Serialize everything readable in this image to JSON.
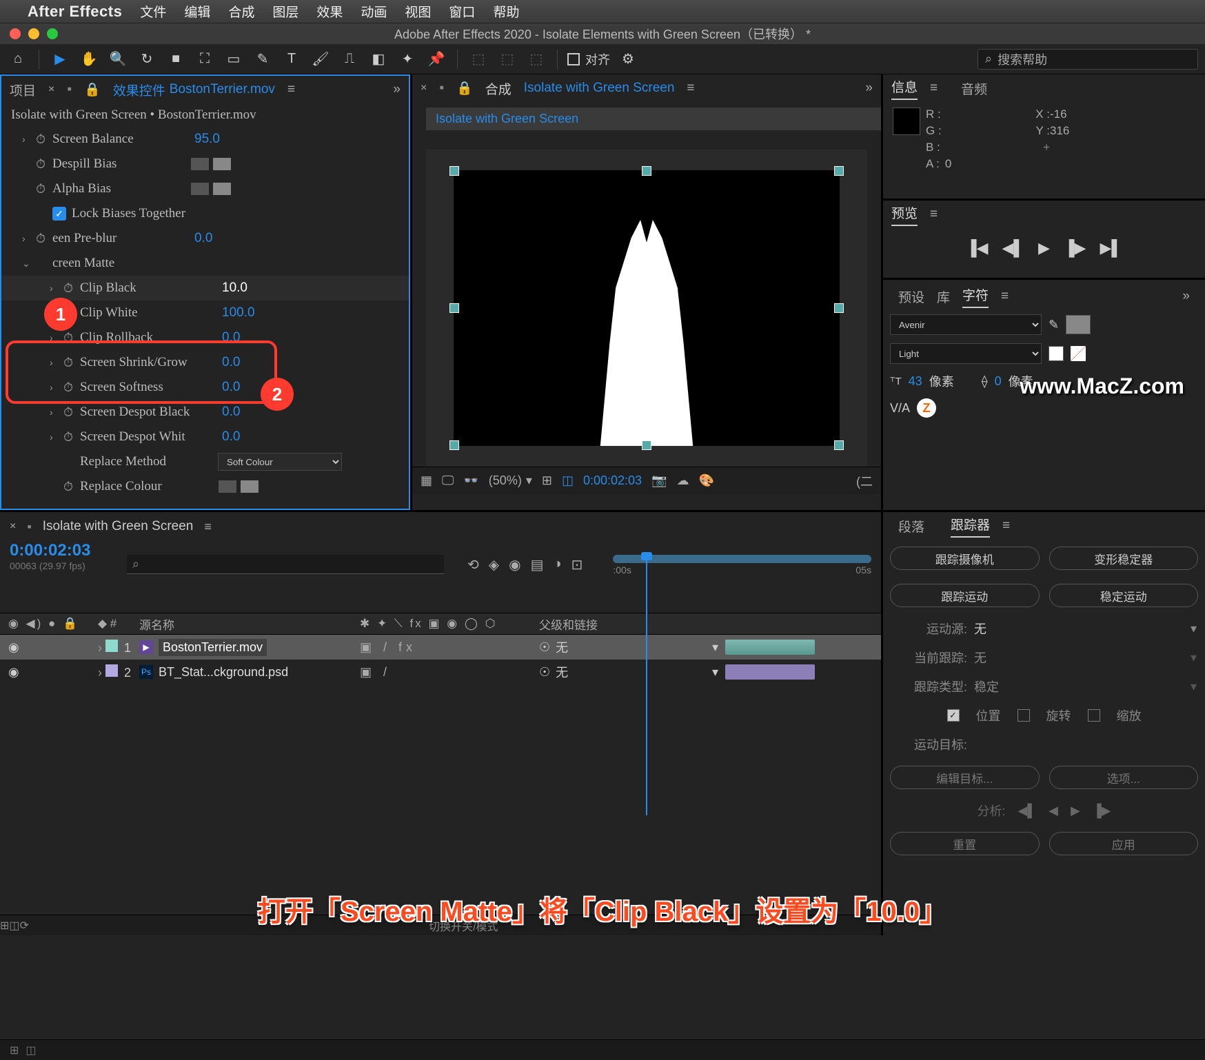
{
  "menubar": {
    "app_name": "After Effects",
    "items": [
      "文件",
      "编辑",
      "合成",
      "图层",
      "效果",
      "动画",
      "视图",
      "窗口",
      "帮助"
    ]
  },
  "window": {
    "title": "Adobe After Effects 2020 - Isolate Elements with Green Screen（已转换） *"
  },
  "toolbar": {
    "align_label": "对齐",
    "search_placeholder": "搜索帮助"
  },
  "effect_panel": {
    "tab_project": "项目",
    "tab_fx": "效果控件",
    "tab_fx_file": "BostonTerrier.mov",
    "crumb": "Isolate with Green Screen • BostonTerrier.mov",
    "props": [
      {
        "name": "Screen Balance",
        "value": "95.0",
        "chev": true,
        "stop": true
      },
      {
        "name": "Despill Bias",
        "value": "",
        "chev": false,
        "stop": true,
        "swatch": true
      },
      {
        "name": "Alpha Bias",
        "value": "",
        "chev": false,
        "stop": true,
        "swatch": true
      },
      {
        "name": "",
        "value": "Lock Biases Together",
        "checkbox": true
      },
      {
        "name": "een Pre-blur",
        "value": "0.0",
        "chev": true,
        "stop": true
      },
      {
        "name": "creen Matte",
        "value": "",
        "chev": true,
        "expanded": true
      },
      {
        "name": "Clip Black",
        "value": "10.0",
        "chev": true,
        "stop": true,
        "indent": true,
        "selected": true,
        "val_white": true
      },
      {
        "name": "Clip White",
        "value": "100.0",
        "chev": true,
        "stop": true,
        "indent": true
      },
      {
        "name": "Clip Rollback",
        "value": "0.0",
        "chev": true,
        "stop": true,
        "indent": true
      },
      {
        "name": "Screen Shrink/Grow",
        "value": "0.0",
        "chev": true,
        "stop": true,
        "indent": true
      },
      {
        "name": "Screen Softness",
        "value": "0.0",
        "chev": true,
        "stop": true,
        "indent": true
      },
      {
        "name": "Screen Despot Black",
        "value": "0.0",
        "chev": true,
        "stop": true,
        "indent": true
      },
      {
        "name": "Screen Despot Whit",
        "value": "0.0",
        "chev": true,
        "stop": true,
        "indent": true
      },
      {
        "name": "Replace Method",
        "value": "Soft Colour",
        "select": true,
        "indent": true
      },
      {
        "name": "Replace Colour",
        "value": "",
        "stop": true,
        "swatch": true,
        "indent": true
      }
    ],
    "badges": {
      "one": "1",
      "two": "2"
    }
  },
  "comp_panel": {
    "tab_label": "合成",
    "tab_name": "Isolate with Green Screen",
    "tag": "Isolate with Green Screen",
    "footer": {
      "zoom": "(50%)",
      "time": "0:00:02:03",
      "mode": "(二"
    }
  },
  "info_panel": {
    "tab_info": "信息",
    "tab_audio": "音频",
    "r_label": "R :",
    "g_label": "G :",
    "b_label": "B :",
    "a_label": "A :",
    "a_val": "0",
    "x_label": "X :",
    "x_val": "-16",
    "y_label": "Y :",
    "y_val": "316"
  },
  "preview_panel": {
    "tab": "预览"
  },
  "preset_tabs": {
    "presets": "预设",
    "library": "库",
    "character": "字符"
  },
  "char_panel": {
    "font": "Avenir",
    "weight": "Light",
    "size_label": "像素",
    "size": "43",
    "lead_label": "像素",
    "lead": "0",
    "watermark": "www.MacZ.com"
  },
  "timeline": {
    "comp_name": "Isolate with Green Screen",
    "timecode": "0:00:02:03",
    "fps": "00063 (29.97 fps)",
    "col_source": "源名称",
    "col_parent": "父级和链接",
    "ticks": [
      ":00s",
      "05s"
    ],
    "layers": [
      {
        "num": "1",
        "name": "BostonTerrier.mov",
        "parent": "无",
        "color": "#8fd9cf",
        "type": "mov",
        "fx": "fx"
      },
      {
        "num": "2",
        "name": "BT_Stat...ckground.psd",
        "parent": "无",
        "color": "#b3a8e0",
        "type": "ps",
        "fx": ""
      }
    ],
    "footer_mode": "切换开关/模式"
  },
  "bottom_tabs": {
    "paragraph": "段落",
    "tracker": "跟踪器"
  },
  "tracker": {
    "btn_track_cam": "跟踪摄像机",
    "btn_warp": "变形稳定器",
    "btn_track_motion": "跟踪运动",
    "btn_stabilize": "稳定运动",
    "motion_source_label": "运动源:",
    "motion_source_val": "无",
    "current_track_label": "当前跟踪:",
    "current_track_val": "无",
    "track_type_label": "跟踪类型:",
    "track_type_val": "稳定",
    "cb_position": "位置",
    "cb_rotation": "旋转",
    "cb_scale": "缩放",
    "motion_target": "运动目标:",
    "edit_target": "编辑目标...",
    "options": "选项...",
    "analyze": "分析:",
    "reset": "重置",
    "apply": "应用"
  },
  "caption": "打开「Screen Matte」将「Clip Black」设置为「10.0」"
}
